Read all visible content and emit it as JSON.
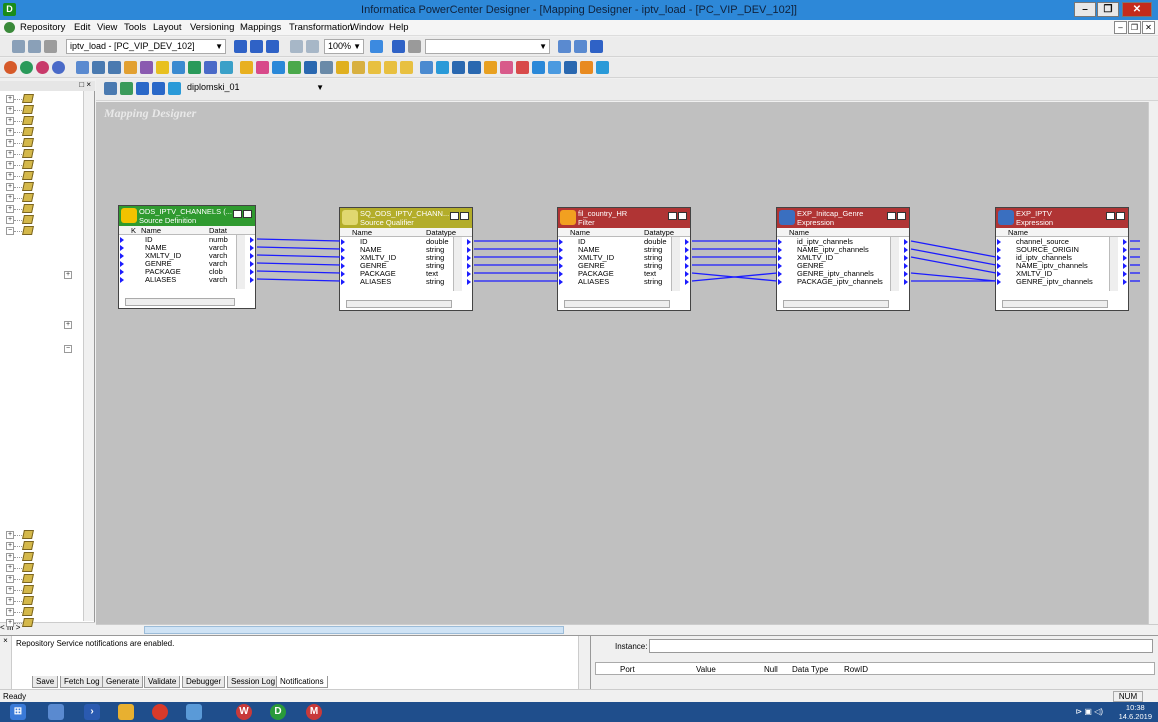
{
  "window": {
    "title": "Informatica PowerCenter Designer - [Mapping Designer - iptv_load - [PC_VIP_DEV_102]]",
    "minimize_label": "–",
    "maximize_label": "❐",
    "close_label": "✕"
  },
  "menu": {
    "items": [
      "Repository",
      "Edit",
      "View",
      "Tools",
      "Layout",
      "Versioning",
      "Mappings",
      "Transformation",
      "Window",
      "Help"
    ],
    "mdi_buttons": [
      "–",
      "❐",
      "✕"
    ]
  },
  "toolbar1": {
    "folder_combo": "iptv_load - [PC_VIP_DEV_102]",
    "zoom_combo": "100%"
  },
  "toolbar3": {
    "mapping_combo": "diplomski_01"
  },
  "workspace": {
    "label": "Mapping Designer"
  },
  "transformations": [
    {
      "name": "ODS_IPTV_CHANNELS (...",
      "type": "Source Definition",
      "header_color": "#2f9a2f",
      "icon_color": "#f2c200",
      "col1": "Name",
      "col2": "Datat",
      "key_col": "K",
      "ports": [
        {
          "name": "ID",
          "type": "numb"
        },
        {
          "name": "NAME",
          "type": "varch"
        },
        {
          "name": "XMLTV_ID",
          "type": "varch"
        },
        {
          "name": "GENRE",
          "type": "varch"
        },
        {
          "name": "PACKAGE",
          "type": "clob"
        },
        {
          "name": "ALIASES",
          "type": "varch"
        }
      ]
    },
    {
      "name": "SQ_ODS_IPTV_CHANN...",
      "type": "Source Qualifier",
      "header_color": "#b3ad2a",
      "icon_color": "#e0d870",
      "col1": "Name",
      "col2": "Datatype",
      "ports": [
        {
          "name": "ID",
          "type": "double"
        },
        {
          "name": "NAME",
          "type": "string"
        },
        {
          "name": "XMLTV_ID",
          "type": "string"
        },
        {
          "name": "GENRE",
          "type": "string"
        },
        {
          "name": "PACKAGE",
          "type": "text"
        },
        {
          "name": "ALIASES",
          "type": "string"
        }
      ]
    },
    {
      "name": "fil_country_HR",
      "type": "Filter",
      "header_color": "#b03434",
      "icon_color": "#f2a020",
      "col1": "Name",
      "col2": "Datatype",
      "ports": [
        {
          "name": "ID",
          "type": "double"
        },
        {
          "name": "NAME",
          "type": "string"
        },
        {
          "name": "XMLTV_ID",
          "type": "string"
        },
        {
          "name": "GENRE",
          "type": "string"
        },
        {
          "name": "PACKAGE",
          "type": "text"
        },
        {
          "name": "ALIASES",
          "type": "string"
        }
      ]
    },
    {
      "name": "EXP_Initcap_Genre",
      "type": "Expression",
      "header_color": "#b03434",
      "icon_color": "#3a6fc0",
      "col1": "Name",
      "col2": "",
      "ports": [
        {
          "name": "id_iptv_channels",
          "type": ""
        },
        {
          "name": "NAME_iptv_channels",
          "type": ""
        },
        {
          "name": "XMLTV_ID",
          "type": ""
        },
        {
          "name": "GENRE",
          "type": ""
        },
        {
          "name": "GENRE_iptv_channels",
          "type": ""
        },
        {
          "name": "PACKAGE_iptv_channels",
          "type": ""
        }
      ]
    },
    {
      "name": "EXP_IPTV",
      "type": "Expression",
      "header_color": "#b03434",
      "icon_color": "#3a6fc0",
      "col1": "Name",
      "col2": "",
      "ports": [
        {
          "name": "channel_source",
          "type": ""
        },
        {
          "name": "SOURCE_ORIGIN",
          "type": ""
        },
        {
          "name": "id_iptv_channels",
          "type": ""
        },
        {
          "name": "NAME_iptv_channels",
          "type": ""
        },
        {
          "name": "XMLTV_ID",
          "type": ""
        },
        {
          "name": "GENRE_iptv_channels",
          "type": ""
        }
      ]
    }
  ],
  "output": {
    "message": "Repository Service notifications are enabled.",
    "tabs": [
      "Save",
      "Fetch Log",
      "Generate",
      "Validate",
      "Debugger",
      "Session Log",
      "Notifications"
    ],
    "active_tab": "Notifications"
  },
  "instance": {
    "label": "Instance:",
    "columns": [
      "Port",
      "Value",
      "Null",
      "Data Type",
      "RowID"
    ]
  },
  "status": {
    "text": "Ready",
    "num": "NUM"
  },
  "taskbar": {
    "time": "10:38",
    "date": "14.6.2019"
  }
}
